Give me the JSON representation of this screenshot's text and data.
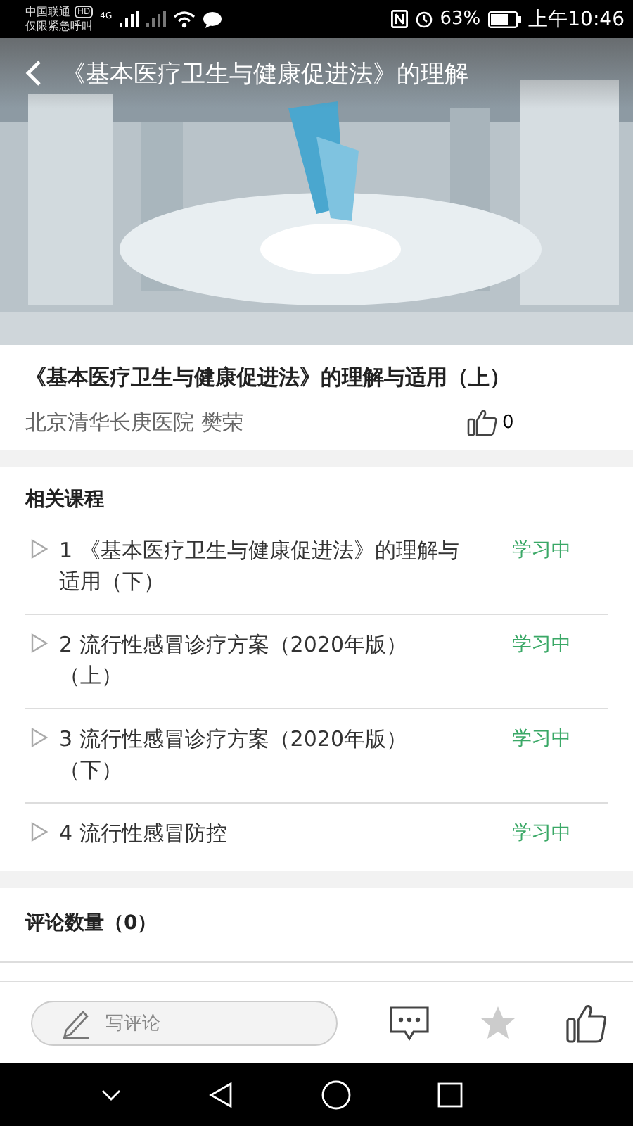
{
  "status_bar": {
    "carrier": "中国联通",
    "carrier_badge": "HD",
    "emergency": "仅限紧急呼叫",
    "network": "4G",
    "battery": "63%",
    "time": "上午10:46"
  },
  "header": {
    "title": "《基本医疗卫生与健康促进法》的理解"
  },
  "course": {
    "title": "《基本医疗卫生与健康促进法》的理解与适用（上）",
    "author": "北京清华长庚医院 樊荣",
    "likes": "0"
  },
  "related": {
    "heading": "相关课程",
    "items": [
      {
        "title": "1 《基本医疗卫生与健康促进法》的理解与适用（下）",
        "status": "学习中"
      },
      {
        "title": "2 流行性感冒诊疗方案（2020年版）（上）",
        "status": "学习中"
      },
      {
        "title": "3 流行性感冒诊疗方案（2020年版）（下）",
        "status": "学习中"
      },
      {
        "title": "4 流行性感冒防控",
        "status": "学习中"
      }
    ]
  },
  "comments": {
    "heading": "评论数量（0）"
  },
  "bottom_bar": {
    "comment_placeholder": "写评论"
  }
}
